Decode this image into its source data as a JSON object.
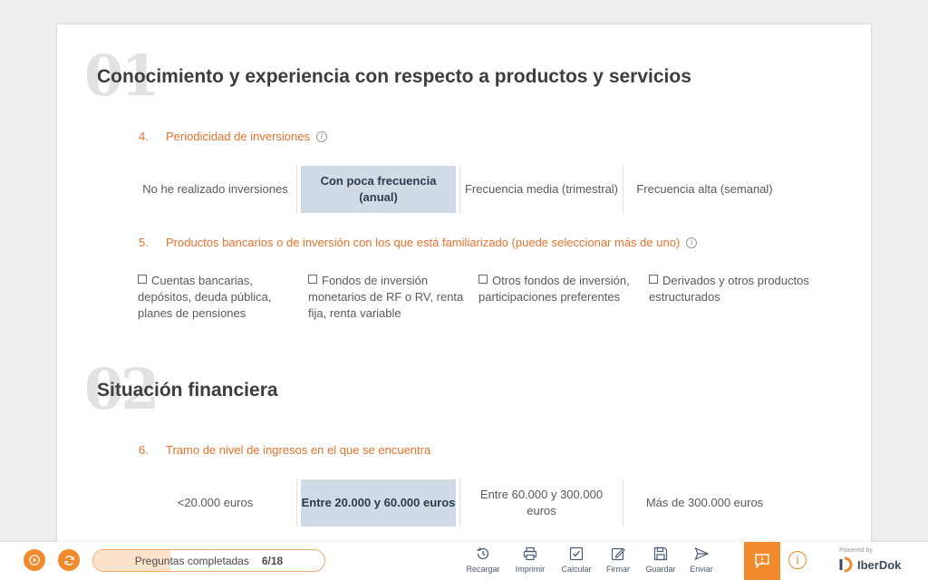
{
  "section1": {
    "number": "01",
    "title": "Conocimiento y experiencia con respecto a productos y servicios"
  },
  "q4": {
    "number": "4.",
    "text": "Periodicidad de inversiones",
    "options": [
      "No he realizado inversiones",
      "Con poca frecuencia (anual)",
      "Frecuencia media (trimestral)",
      "Frecuencia alta (semanal)"
    ],
    "selected_index": 1
  },
  "q5": {
    "number": "5.",
    "text": "Productos bancarios o de inversión con los que está familiarizado (puede seleccionar más de uno)",
    "options": [
      "Cuentas bancarias, depósitos, deuda pública, planes de pensiones",
      "Fondos de inversión monetarios de RF o RV, renta fija, renta variable",
      "Otros fondos de inversión, participaciones preferentes",
      "Derivados y otros productos estructurados"
    ]
  },
  "section2": {
    "number": "02",
    "title": "Situación financiera"
  },
  "q6": {
    "number": "6.",
    "text": "Tramo de nivel de ingresos en el que se encuentra",
    "options": [
      "<20.000 euros",
      "Entre 20.000 y 60.000 euros",
      "Entre 60.000 y 300.000 euros",
      "Más de 300.000 euros"
    ],
    "selected_index": 1
  },
  "footer": {
    "progress_label": "Preguntas completadas",
    "progress_count": "6/18",
    "progress_fraction": 0.333,
    "tools": {
      "reload": "Recargar",
      "print": "Imprimir",
      "calculate": "Calcular",
      "sign": "Firmar",
      "save": "Guardar",
      "send": "Enviar"
    },
    "powered_by": "Powered by",
    "brand": "IberDok"
  },
  "colors": {
    "accent": "#f08a2c",
    "question": "#e8722d",
    "selected_bg": "#d1dbe5"
  },
  "icons": [
    "play-icon",
    "refresh-icon",
    "history-icon",
    "printer-icon",
    "checkbox-icon",
    "pen-icon",
    "save-icon",
    "send-icon",
    "feedback-icon",
    "info-icon"
  ]
}
